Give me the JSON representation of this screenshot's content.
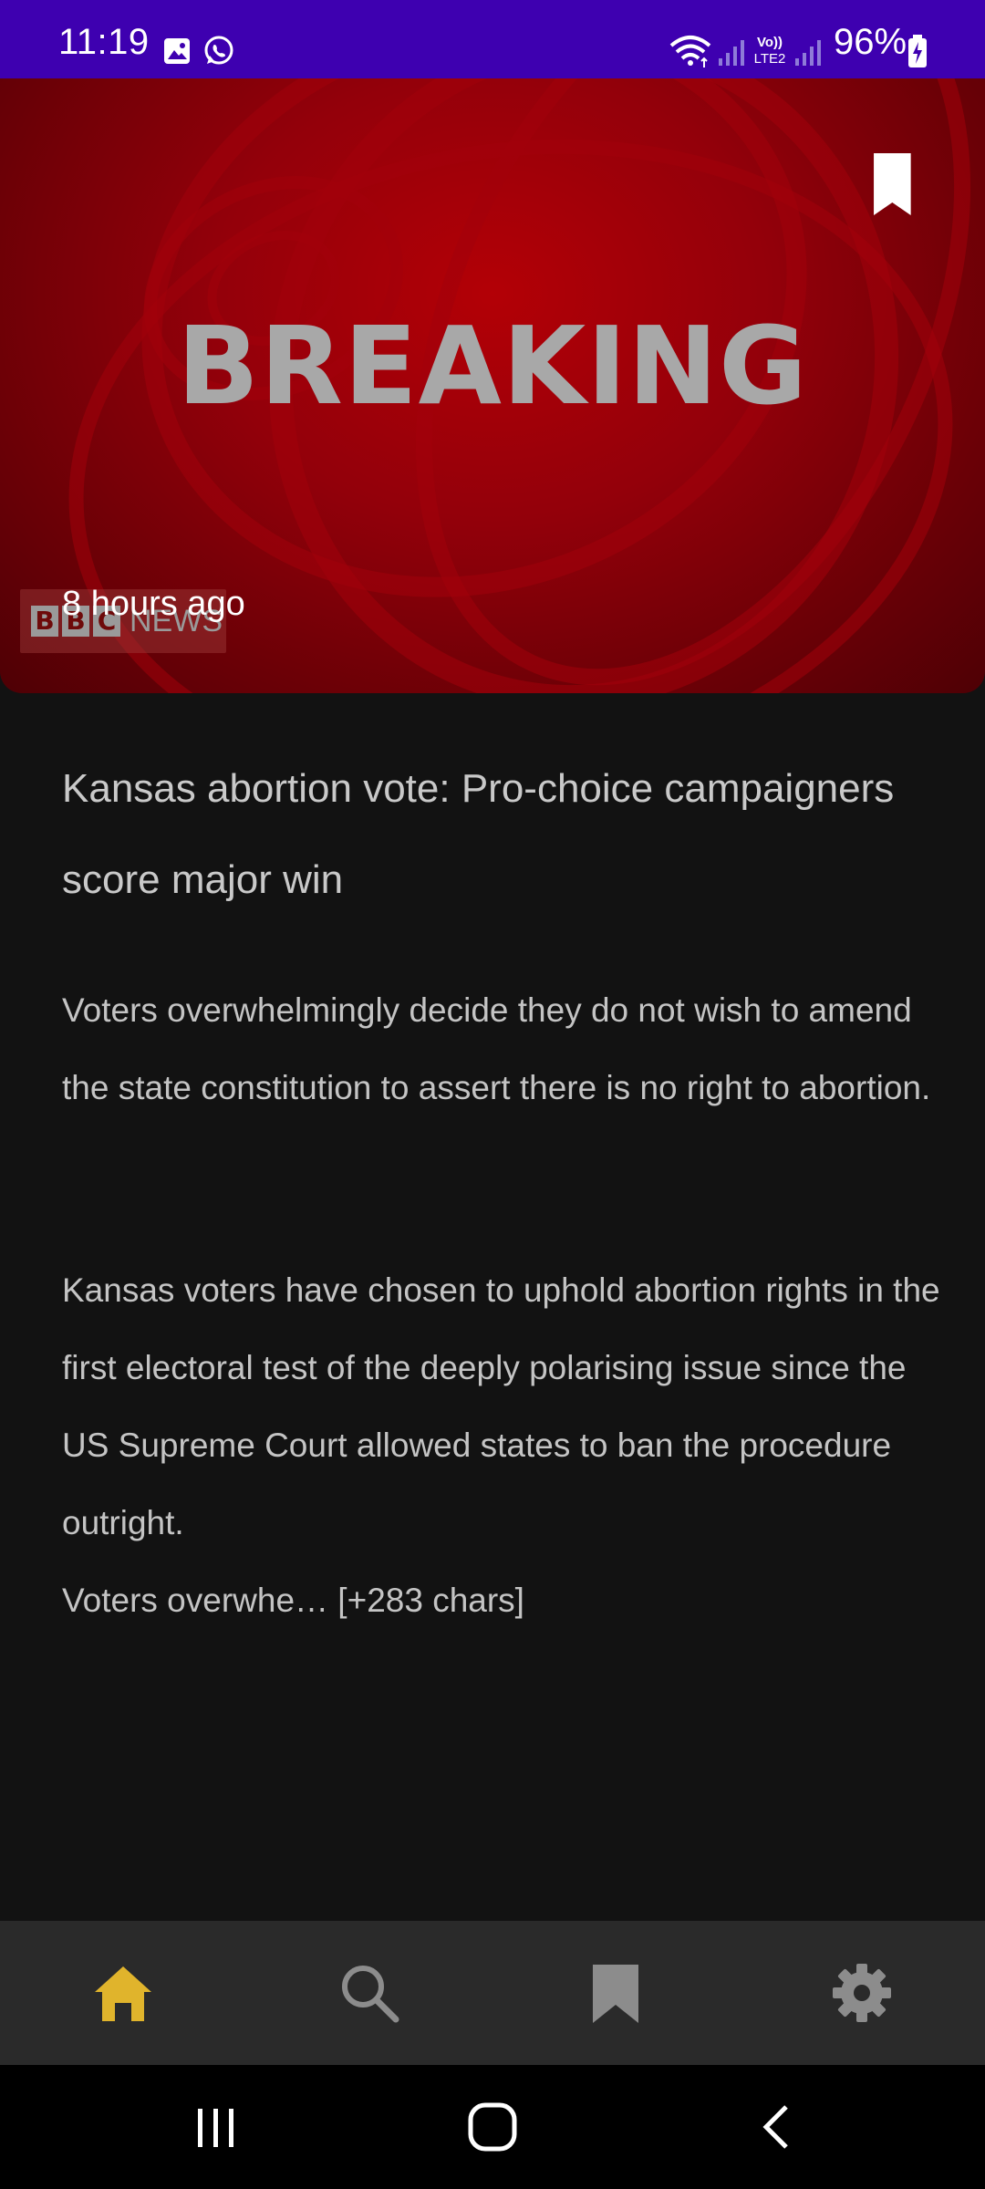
{
  "status_bar": {
    "time": "11:19",
    "battery": "96%",
    "network_label": "LTE2",
    "icons": [
      "gallery-icon",
      "whatsapp-icon",
      "wifi-icon",
      "signal-icon",
      "volte-icon",
      "signal-icon",
      "battery-charging-icon"
    ],
    "background_color": "#3e00b0"
  },
  "hero": {
    "headline_text": "BREAKING",
    "logo_text": "BBC NEWS",
    "timestamp": "8 hours ago",
    "bookmark_icon": "bookmark-icon",
    "accent_color": "#93000a"
  },
  "article": {
    "title": "Kansas abortion vote: Pro-choice campaigners score major win",
    "summary": "Voters overwhelmingly decide they do not wish to amend the state constitution to assert there is no right to abortion.",
    "body": "Kansas voters have chosen to uphold abortion rights in the first electoral test of the deeply polarising issue since the US Supreme Court allowed states to ban the procedure outright.",
    "truncated_text": "Voters overwhe… [+283 chars]"
  },
  "bottom_nav": {
    "items": [
      {
        "name": "home",
        "icon": "home-icon",
        "active": true
      },
      {
        "name": "search",
        "icon": "search-icon",
        "active": false
      },
      {
        "name": "bookmarks",
        "icon": "bookmark-icon",
        "active": false
      },
      {
        "name": "settings",
        "icon": "gear-icon",
        "active": false
      }
    ],
    "active_color": "#e0b42c",
    "inactive_color": "#8c8c8c"
  },
  "system_nav": {
    "buttons": [
      "recent-apps-icon",
      "home-circle-icon",
      "back-icon"
    ]
  }
}
